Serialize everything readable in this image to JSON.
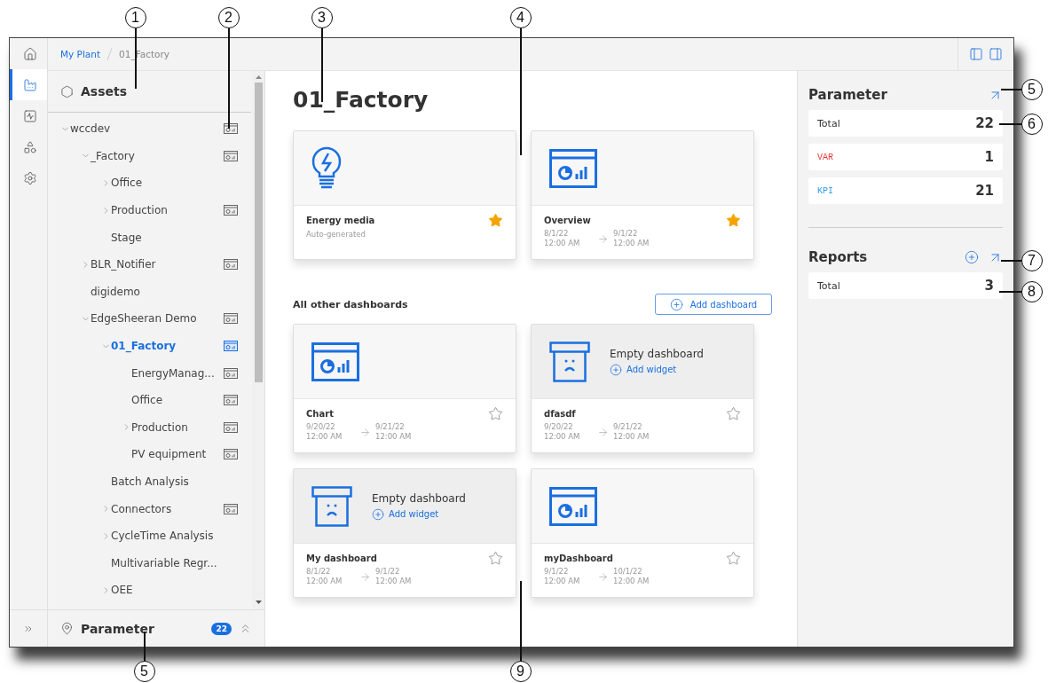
{
  "callouts": [
    {
      "label": "1"
    },
    {
      "label": "2"
    },
    {
      "label": "3"
    },
    {
      "label": "4"
    },
    {
      "label": "5"
    },
    {
      "label": "6"
    },
    {
      "label": "7"
    },
    {
      "label": "8"
    },
    {
      "label": "5"
    },
    {
      "label": "9"
    }
  ],
  "rail": {
    "items": [
      {
        "kind": "home",
        "selected": false
      },
      {
        "kind": "assets",
        "selected": true
      },
      {
        "kind": "monitor",
        "selected": false
      },
      {
        "kind": "shapes",
        "selected": false
      },
      {
        "kind": "settings",
        "selected": false
      }
    ]
  },
  "breadcrumb": [
    {
      "label": "My Plant",
      "link": true
    },
    {
      "label": "01_Factory",
      "link": false
    }
  ],
  "sidebar": {
    "title": "Assets",
    "tree": [
      {
        "label": "wccdev",
        "kind": "folder",
        "expanded": true,
        "dashboard": true,
        "selected": false,
        "children": [
          {
            "label": "_Factory",
            "kind": "folder",
            "expanded": true,
            "dashboard": true,
            "selected": false,
            "children": [
              {
                "label": "Office",
                "kind": "folder",
                "expanded": false,
                "dashboard": false,
                "selected": false
              },
              {
                "label": "Production",
                "kind": "folder",
                "expanded": false,
                "dashboard": true,
                "selected": false
              },
              {
                "label": "Stage",
                "kind": "leaf",
                "dashboard": false,
                "selected": false
              }
            ]
          },
          {
            "label": "BLR_Notifier",
            "kind": "folder",
            "expanded": false,
            "dashboard": true,
            "selected": false
          },
          {
            "label": "digidemo",
            "kind": "leaf",
            "dashboard": false,
            "selected": false
          },
          {
            "label": "EdgeSheeran Demo",
            "kind": "folder",
            "expanded": true,
            "dashboard": true,
            "selected": false,
            "children": [
              {
                "label": "01_Factory",
                "kind": "folder",
                "expanded": true,
                "dashboard": true,
                "selected": true,
                "children": [
                  {
                    "label": "EnergyManag...",
                    "kind": "leaf",
                    "dashboard": true,
                    "selected": false
                  },
                  {
                    "label": "Office",
                    "kind": "leaf",
                    "dashboard": true,
                    "selected": false
                  },
                  {
                    "label": "Production",
                    "kind": "folder",
                    "expanded": false,
                    "dashboard": true,
                    "selected": false
                  },
                  {
                    "label": "PV equipment",
                    "kind": "leaf",
                    "dashboard": true,
                    "selected": false
                  }
                ]
              },
              {
                "label": "Batch Analysis",
                "kind": "leaf",
                "dashboard": false,
                "selected": false
              },
              {
                "label": "Connectors",
                "kind": "folder",
                "expanded": false,
                "dashboard": true,
                "selected": false
              },
              {
                "label": "CycleTime Analysis",
                "kind": "folder",
                "expanded": false,
                "dashboard": false,
                "selected": false
              },
              {
                "label": "Multivariable Regr...",
                "kind": "leaf",
                "dashboard": false,
                "selected": false
              },
              {
                "label": "OEE",
                "kind": "folder",
                "expanded": false,
                "dashboard": false,
                "selected": false
              }
            ]
          }
        ]
      }
    ],
    "footer": {
      "title": "Parameter",
      "count": "22"
    }
  },
  "main": {
    "title": "01_Factory",
    "favorites": [
      {
        "kind": "energy",
        "name": "Energy media",
        "subtitle": "Auto-generated",
        "favorite": true
      },
      {
        "kind": "dashboard",
        "name": "Overview",
        "from": {
          "date": "8/1/22",
          "time": "12:00 AM"
        },
        "to": {
          "date": "9/1/22",
          "time": "12:00 AM"
        },
        "favorite": true
      }
    ],
    "others_title": "All other dashboards",
    "add_button": "Add dashboard",
    "others": [
      {
        "kind": "dashboard",
        "name": "Chart",
        "from": {
          "date": "9/20/22",
          "time": "12:00 AM"
        },
        "to": {
          "date": "9/21/22",
          "time": "12:00 AM"
        },
        "favorite": false
      },
      {
        "kind": "empty",
        "message": "Empty dashboard",
        "action": "Add widget",
        "name": "dfasdf",
        "from": {
          "date": "9/20/22",
          "time": "12:00 AM"
        },
        "to": {
          "date": "9/21/22",
          "time": "12:00 AM"
        },
        "favorite": false
      },
      {
        "kind": "empty",
        "message": "Empty dashboard",
        "action": "Add widget",
        "name": "My dashboard",
        "from": {
          "date": "8/1/22",
          "time": "12:00 AM"
        },
        "to": {
          "date": "9/1/22",
          "time": "12:00 AM"
        },
        "favorite": false
      },
      {
        "kind": "dashboard",
        "name": "myDashboard",
        "from": {
          "date": "9/1/22",
          "time": "12:00 AM"
        },
        "to": {
          "date": "10/1/22",
          "time": "12:00 AM"
        },
        "favorite": false
      }
    ]
  },
  "right": {
    "parameter": {
      "title": "Parameter",
      "rows": [
        {
          "kind": "total",
          "label": "Total",
          "value": "22"
        },
        {
          "kind": "var",
          "label": "VAR",
          "value": "1"
        },
        {
          "kind": "kpi",
          "label": "KPI",
          "value": "21"
        }
      ]
    },
    "reports": {
      "title": "Reports",
      "rows": [
        {
          "kind": "total",
          "label": "Total",
          "value": "3"
        }
      ]
    }
  }
}
